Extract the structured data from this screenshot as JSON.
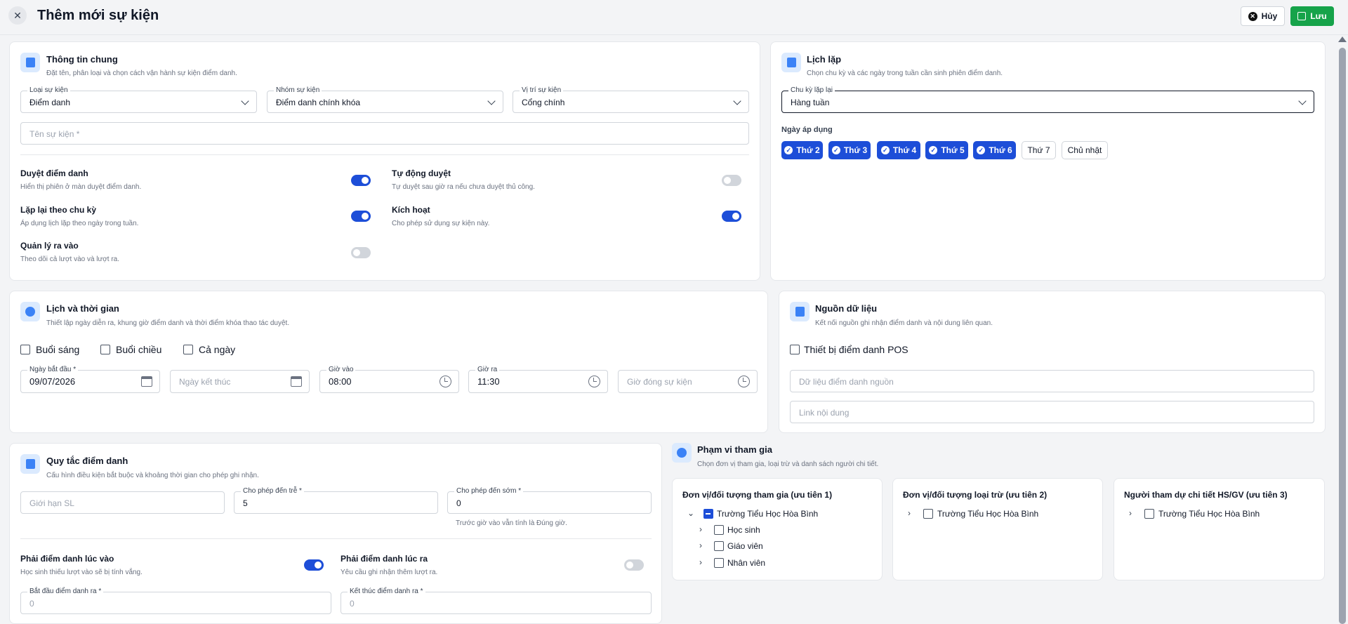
{
  "header": {
    "title": "Thêm mới sự kiện",
    "cancel_label": "Hủy",
    "save_label": "Lưu"
  },
  "general": {
    "title": "Thông tin chung",
    "subtitle": "Đặt tên, phân loại và chọn cách vận hành sự kiện điểm danh.",
    "event_type": {
      "label": "Loại sự kiện",
      "value": "Điểm danh"
    },
    "event_group": {
      "label": "Nhóm sự kiện",
      "value": "Điểm danh chính khóa"
    },
    "event_location": {
      "label": "Vị trí sự kiện",
      "value": "Cổng chính"
    },
    "event_name": {
      "placeholder": "Tên sự kiện *"
    },
    "toggles": [
      {
        "label": "Duyệt điểm danh",
        "desc": "Hiển thị phiên ở màn duyệt điểm danh.",
        "on": true
      },
      {
        "label": "Tự động duyệt",
        "desc": "Tự duyệt sau giờ ra nếu chưa duyệt thủ công.",
        "on": false
      },
      {
        "label": "Lặp lại theo chu kỳ",
        "desc": "Áp dụng lịch lặp theo ngày trong tuần.",
        "on": true
      },
      {
        "label": "Kích hoạt",
        "desc": "Cho phép sử dụng sự kiện này.",
        "on": true
      },
      {
        "label": "Quản lý ra vào",
        "desc": "Theo dõi cả lượt vào và lượt ra.",
        "on": false
      }
    ]
  },
  "repeat": {
    "title": "Lịch lặp",
    "subtitle": "Chọn chu kỳ và các ngày trong tuần cần sinh phiên điểm danh.",
    "cycle": {
      "label": "Chu kỳ lặp lại",
      "value": "Hàng tuần"
    },
    "days_label": "Ngày áp dụng",
    "days": [
      {
        "label": "Thứ 2",
        "selected": true
      },
      {
        "label": "Thứ 3",
        "selected": true
      },
      {
        "label": "Thứ 4",
        "selected": true
      },
      {
        "label": "Thứ 5",
        "selected": true
      },
      {
        "label": "Thứ 6",
        "selected": true
      },
      {
        "label": "Thứ 7",
        "selected": false
      },
      {
        "label": "Chủ nhật",
        "selected": false
      }
    ]
  },
  "schedule": {
    "title": "Lịch và thời gian",
    "subtitle": "Thiết lập ngày diễn ra, khung giờ điểm danh và thời điểm khóa thao tác duyệt.",
    "sessions": [
      "Buổi sáng",
      "Buổi chiều",
      "Cả ngày"
    ],
    "start_date": {
      "label": "Ngày bắt đầu *",
      "value": "09/07/2026"
    },
    "end_date": {
      "placeholder": "Ngày kết thúc"
    },
    "time_in": {
      "label": "Giờ vào",
      "value": "08:00"
    },
    "time_out": {
      "label": "Giờ ra",
      "value": "11:30"
    },
    "close_time": {
      "placeholder": "Giờ đóng sự kiện"
    }
  },
  "source": {
    "title": "Nguồn dữ liệu",
    "subtitle": "Kết nối nguồn ghi nhận điểm danh và nội dung liên quan.",
    "pos_label": "Thiết bị điểm danh POS",
    "source_placeholder": "Dữ liệu điểm danh nguồn",
    "link_placeholder": "Link nội dung"
  },
  "rules": {
    "title": "Quy tắc điểm danh",
    "subtitle": "Cấu hình điều kiện bắt buộc và khoảng thời gian cho phép ghi nhận.",
    "limit_placeholder": "Giới hạn SL",
    "late": {
      "label": "Cho phép đến trễ *",
      "value": "5"
    },
    "early": {
      "label": "Cho phép đến sớm *",
      "value": "0"
    },
    "early_note": "Trước giờ vào vẫn tính là Đúng giờ.",
    "in_toggle": {
      "label": "Phải điểm danh lúc vào",
      "desc": "Học sinh thiếu lượt vào sẽ bị tính vắng.",
      "on": true
    },
    "out_toggle": {
      "label": "Phải điểm danh lúc ra",
      "desc": "Yêu cầu ghi nhận thêm lượt ra.",
      "on": false
    },
    "out_start": {
      "label": "Bắt đầu điểm danh ra *",
      "value": "0"
    },
    "out_end": {
      "label": "Kết thúc điểm danh ra *",
      "value": "0"
    }
  },
  "scope": {
    "title": "Phạm vi tham gia",
    "subtitle": "Chọn đơn vị tham gia, loại trừ và danh sách người chi tiết.",
    "panels": [
      {
        "title": "Đơn vị/đối tượng tham gia (ưu tiên 1)",
        "root": "Trường Tiểu Học Hòa Bình",
        "children": [
          "Học sinh",
          "Giáo viên",
          "Nhân viên"
        ]
      },
      {
        "title": "Đơn vị/đối tượng loại trừ (ưu tiên 2)",
        "root": "Trường Tiểu Học Hòa Bình"
      },
      {
        "title": "Người tham dự chi tiết HS/GV (ưu tiên 3)",
        "root": "Trường Tiểu Học Hòa Bình"
      }
    ]
  }
}
